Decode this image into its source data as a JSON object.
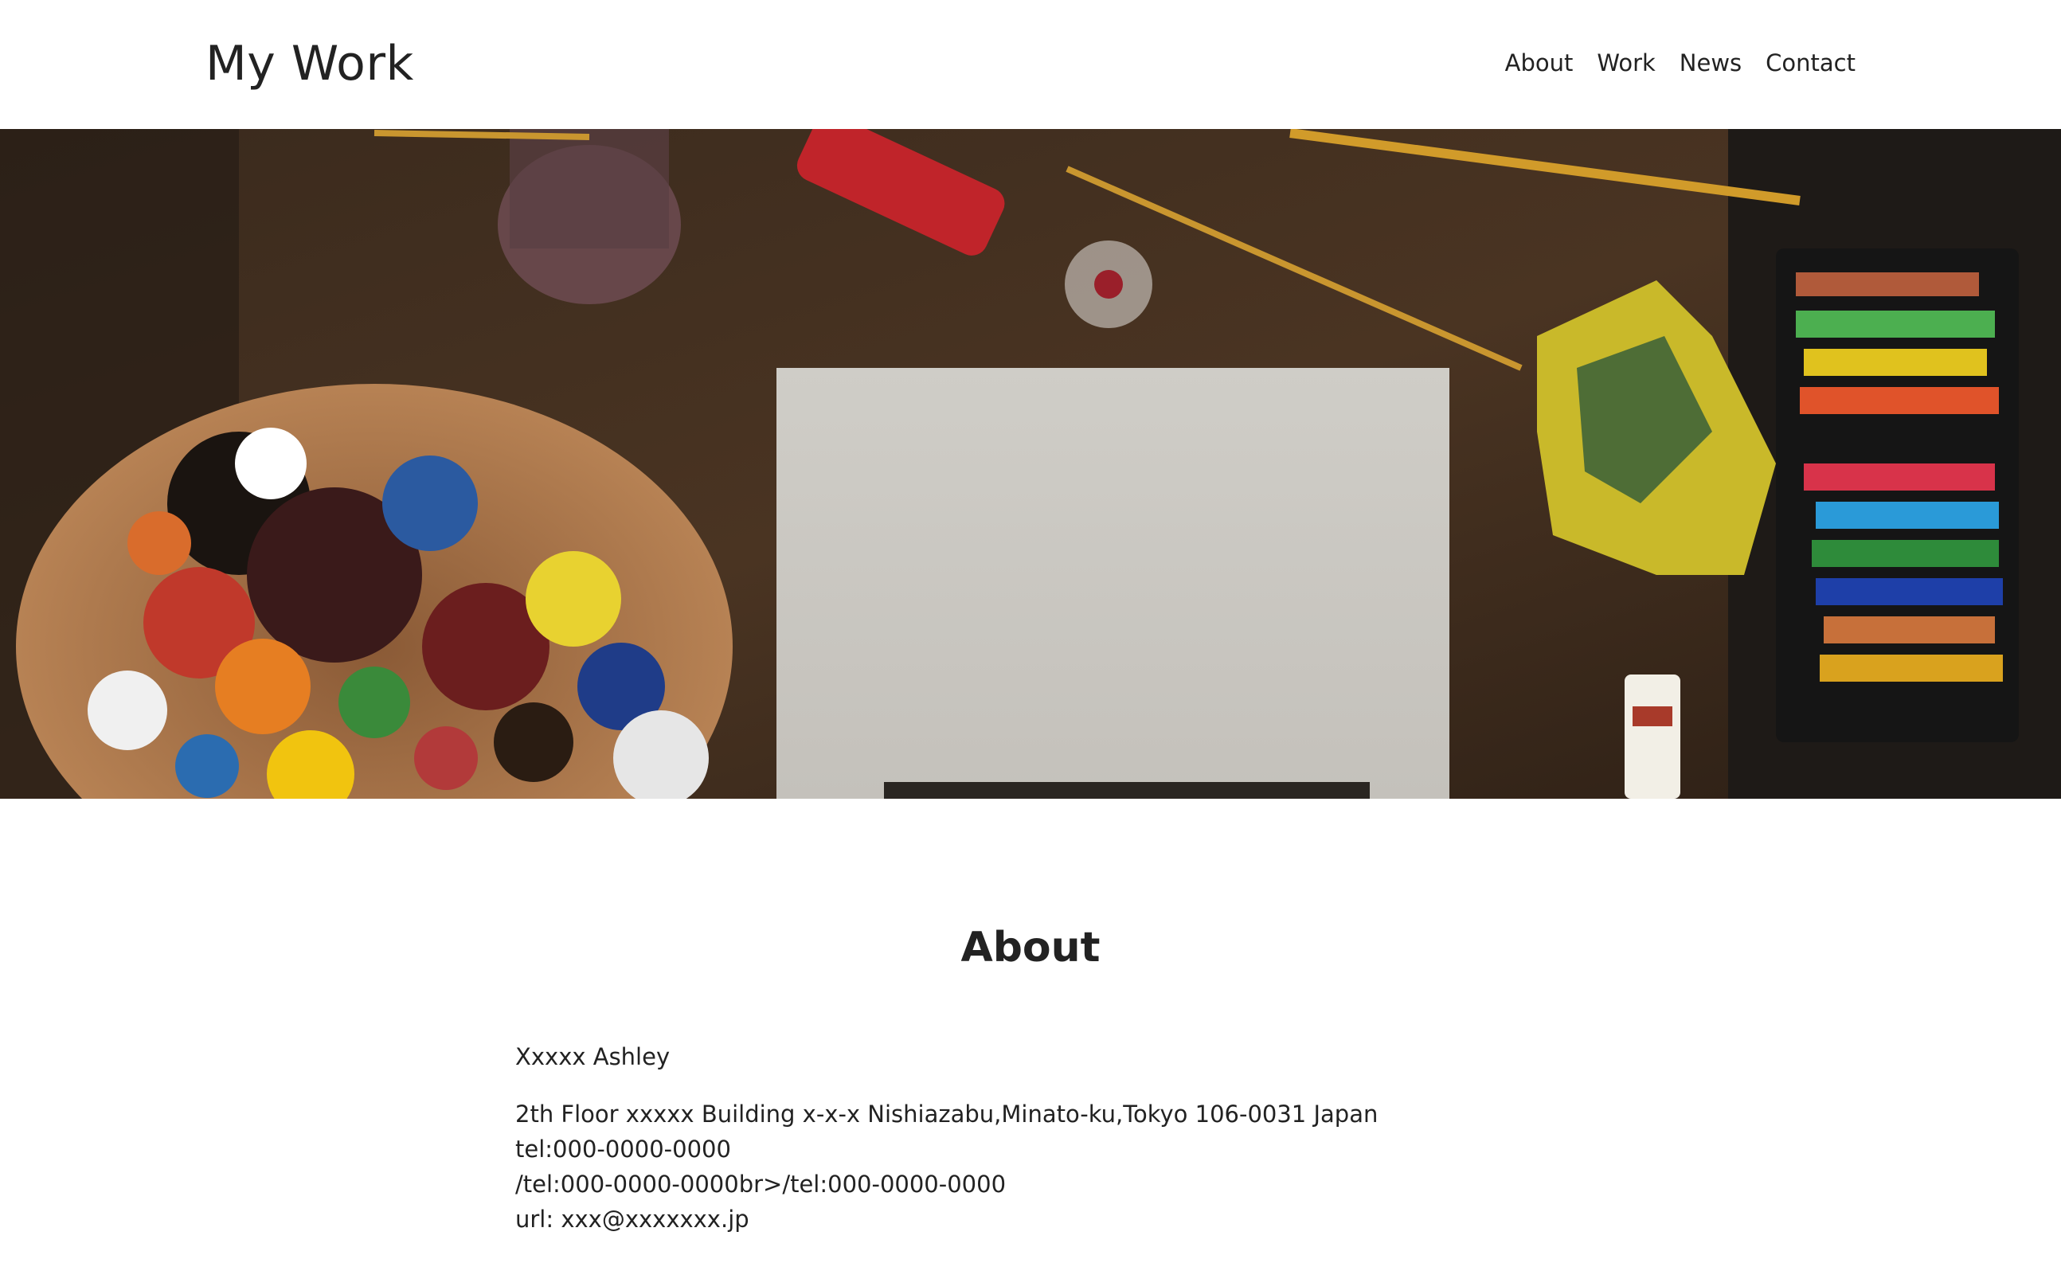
{
  "header": {
    "logo": "My Work",
    "nav": [
      "About",
      "Work",
      "News",
      "Contact"
    ]
  },
  "hero": {
    "image": "artist desk with paint palette, blank canvas, brushes, cloth and paint set"
  },
  "about": {
    "title": "About",
    "name": "Xxxxx Ashley",
    "address_lines": [
      "2th Floor xxxxx Building x-x-x Nishiazabu,Minato-ku,Tokyo 106-0031 Japan",
      "tel:000-0000-0000",
      "/tel:000-0000-0000br>/tel:000-0000-0000",
      "url: xxx@xxxxxxx.jp"
    ]
  }
}
